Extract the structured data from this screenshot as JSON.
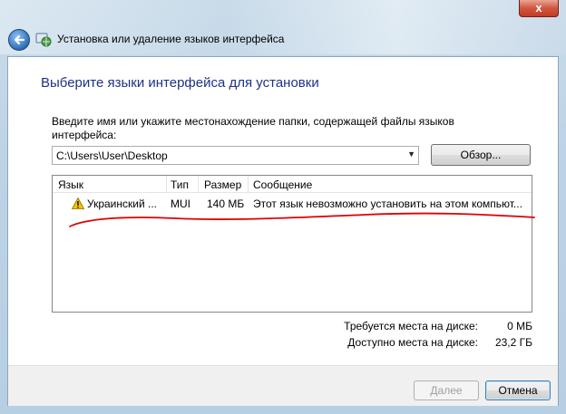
{
  "window": {
    "title": "Установка или удаление языков интерфейса",
    "close_glyph": "x"
  },
  "page": {
    "heading": "Выберите языки интерфейса для установки",
    "instruction": "Введите имя или укажите местонахождение папки, содержащей файлы языков интерфейса:"
  },
  "path": {
    "value": "C:\\Users\\User\\Desktop"
  },
  "browse_label": "Обзор...",
  "table": {
    "headers": {
      "language": "Язык",
      "type": "Тип",
      "size": "Размер",
      "message": "Сообщение"
    },
    "rows": [
      {
        "language": "Украинский ...",
        "type": "MUI",
        "size": "140 МБ",
        "message": "Этот язык невозможно установить на этом компьют...",
        "icon": "warning-icon"
      }
    ]
  },
  "disk": {
    "required_label": "Требуется места на диске:",
    "required_value": "0 МБ",
    "available_label": "Доступно места на диске:",
    "available_value": "23,2 ГБ"
  },
  "buttons": {
    "next": "Далее",
    "cancel": "Отмена"
  },
  "colors": {
    "heading": "#1e3287",
    "annotation": "#e00000",
    "warning": "#f5c400"
  }
}
